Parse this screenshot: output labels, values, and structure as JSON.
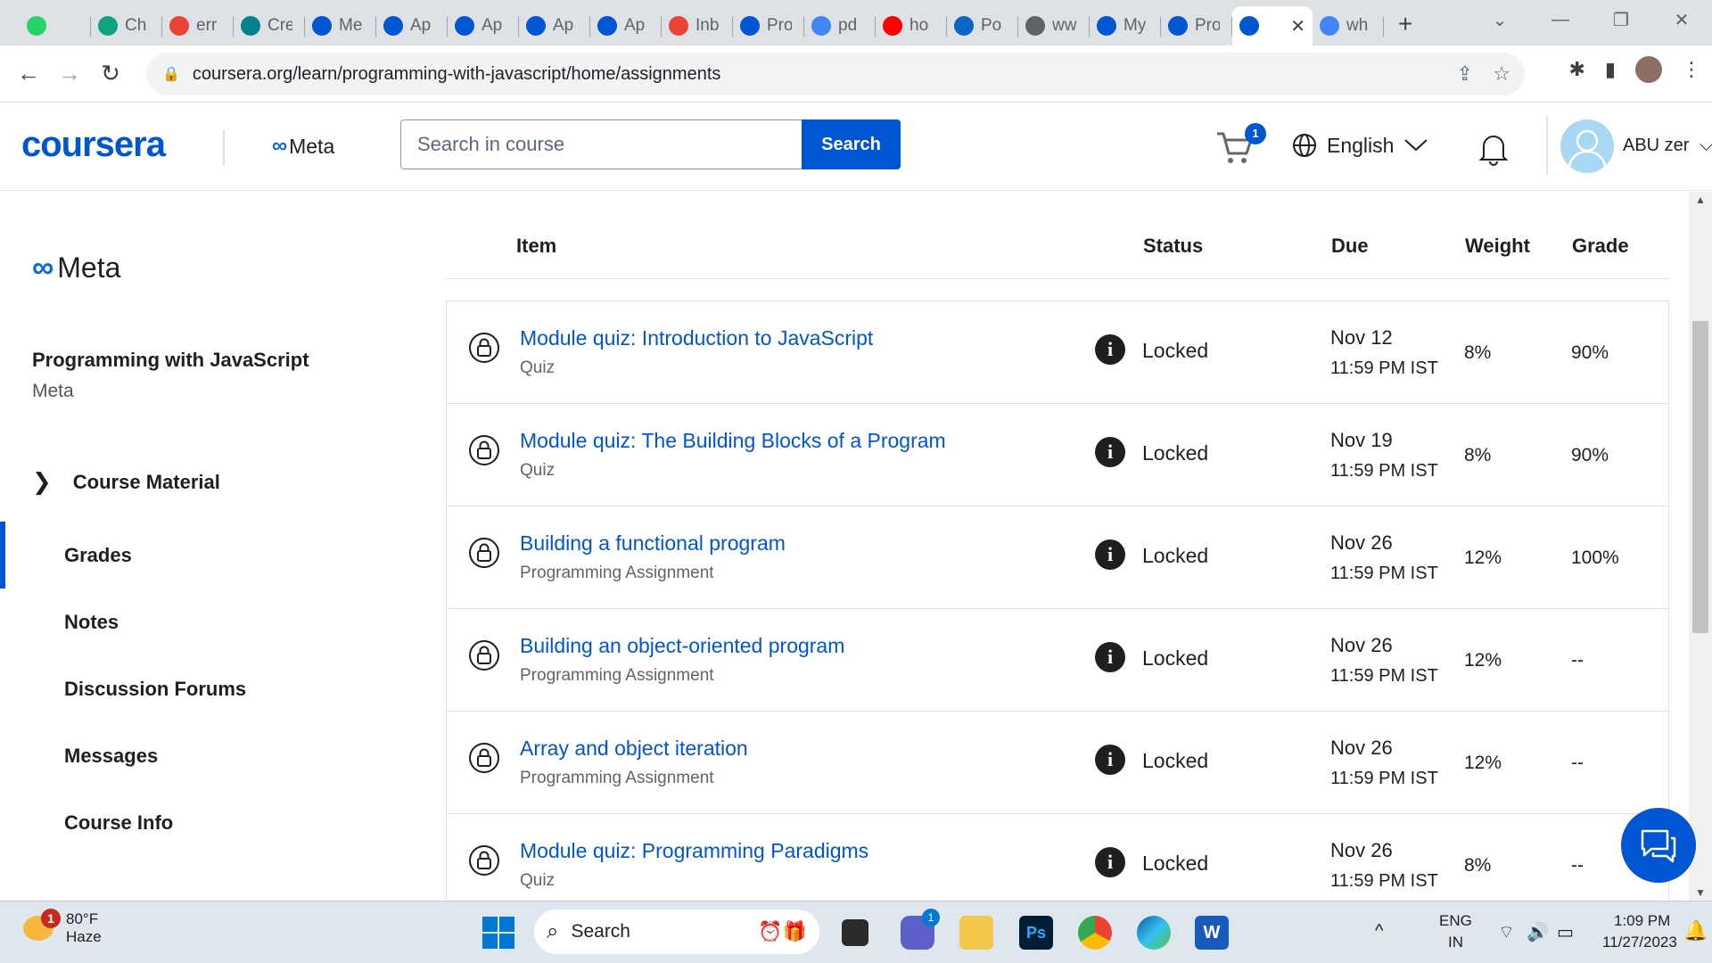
{
  "browser": {
    "tabs": [
      {
        "title": "",
        "icon": "whatsapp-icon",
        "color": "#25d366"
      },
      {
        "title": "Ch",
        "icon": "chatgpt-icon",
        "color": "#10a37f"
      },
      {
        "title": "err",
        "icon": "gmail-icon",
        "color": "#ea4335"
      },
      {
        "title": "Cre",
        "icon": "site-icon",
        "color": "#00838f"
      },
      {
        "title": "Me",
        "icon": "coursera-c-icon",
        "color": "#0056d2"
      },
      {
        "title": "Ap",
        "icon": "coursera-c-icon",
        "color": "#0056d2"
      },
      {
        "title": "Ap",
        "icon": "coursera-c-icon",
        "color": "#0056d2"
      },
      {
        "title": "Ap",
        "icon": "coursera-c-icon",
        "color": "#0056d2"
      },
      {
        "title": "Ap",
        "icon": "coursera-c-icon",
        "color": "#0056d2"
      },
      {
        "title": "Inb",
        "icon": "gmail-icon",
        "color": "#ea4335"
      },
      {
        "title": "Pro",
        "icon": "coursera-c-icon",
        "color": "#0056d2"
      },
      {
        "title": "pd",
        "icon": "google-icon",
        "color": "#4285f4"
      },
      {
        "title": "ho",
        "icon": "youtube-icon",
        "color": "#ff0000"
      },
      {
        "title": "Po",
        "icon": "linkedin-icon",
        "color": "#0a66c2"
      },
      {
        "title": "ww",
        "icon": "globe-icon",
        "color": "#5f6368"
      },
      {
        "title": "My",
        "icon": "coursera-icon",
        "color": "#0056d2"
      },
      {
        "title": "Pro",
        "icon": "coursera-icon",
        "color": "#0056d2"
      },
      {
        "title": "",
        "icon": "coursera-icon",
        "color": "#0056d2",
        "active": true
      },
      {
        "title": "wh",
        "icon": "google-icon",
        "color": "#4285f4"
      }
    ],
    "url": "coursera.org/learn/programming-with-javascript/home/assignments"
  },
  "header": {
    "logo": "coursera",
    "partner": "Meta",
    "search_placeholder": "Search in course",
    "search_button": "Search",
    "cart_count": "1",
    "language": "English",
    "user_name": "ABU zer"
  },
  "sidebar": {
    "partner": "Meta",
    "course_title": "Programming with JavaScript",
    "course_org": "Meta",
    "course_material": "Course Material",
    "items": [
      {
        "label": "Grades",
        "active": true
      },
      {
        "label": "Notes"
      },
      {
        "label": "Discussion Forums"
      },
      {
        "label": "Messages"
      },
      {
        "label": "Course Info"
      }
    ]
  },
  "table": {
    "headers": {
      "item": "Item",
      "status": "Status",
      "due": "Due",
      "weight": "Weight",
      "grade": "Grade"
    },
    "rows": [
      {
        "name": "Module quiz: Introduction to JavaScript",
        "type": "Quiz",
        "status": "Locked",
        "date": "Nov 12",
        "time": "11:59 PM IST",
        "weight": "8%",
        "grade": "90%"
      },
      {
        "name": "Module quiz: The Building Blocks of a Program",
        "type": "Quiz",
        "status": "Locked",
        "date": "Nov 19",
        "time": "11:59 PM IST",
        "weight": "8%",
        "grade": "90%"
      },
      {
        "name": "Building a functional program",
        "type": "Programming Assignment",
        "status": "Locked",
        "date": "Nov 26",
        "time": "11:59 PM IST",
        "weight": "12%",
        "grade": "100%"
      },
      {
        "name": "Building an object-oriented program",
        "type": "Programming Assignment",
        "status": "Locked",
        "date": "Nov 26",
        "time": "11:59 PM IST",
        "weight": "12%",
        "grade": "--"
      },
      {
        "name": "Array and object iteration",
        "type": "Programming Assignment",
        "status": "Locked",
        "date": "Nov 26",
        "time": "11:59 PM IST",
        "weight": "12%",
        "grade": "--"
      },
      {
        "name": "Module quiz: Programming Paradigms",
        "type": "Quiz",
        "status": "Locked",
        "date": "Nov 26",
        "time": "11:59 PM IST",
        "weight": "8%",
        "grade": "--"
      }
    ]
  },
  "taskbar": {
    "weather_temp": "80°F",
    "weather_desc": "Haze",
    "weather_badge": "1",
    "search_label": "Search",
    "lang_1": "ENG",
    "lang_2": "IN",
    "time": "1:09 PM",
    "date": "11/27/2023",
    "chat_badge": "1"
  },
  "colors": {
    "accent": "#0056d2"
  }
}
